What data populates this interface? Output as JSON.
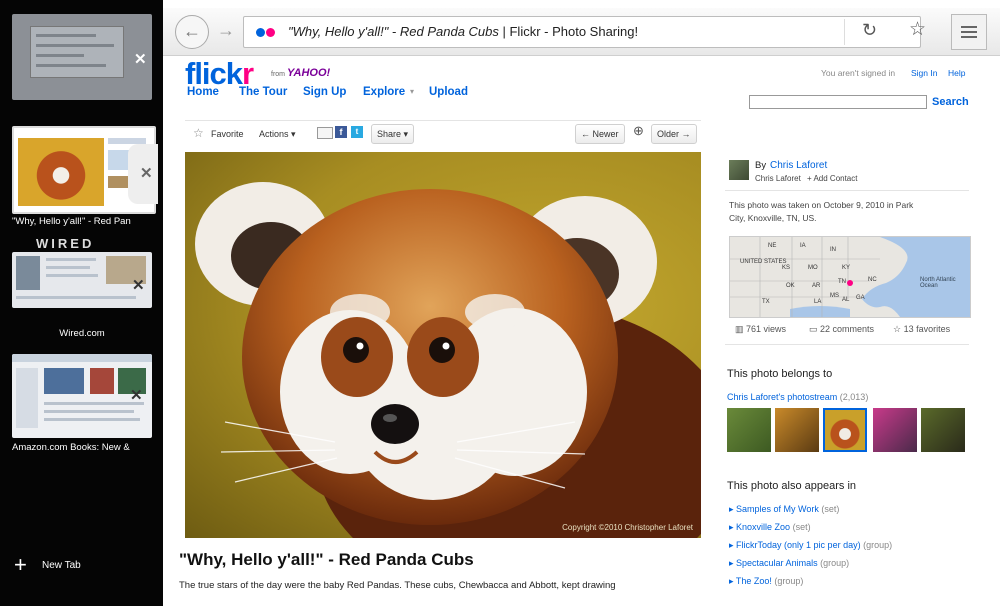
{
  "sidebar": {
    "tabs": [
      {
        "label": ""
      },
      {
        "label": "\"Why, Hello y'all!\" - Red Pan"
      },
      {
        "label": "Wired.com"
      },
      {
        "label": "Amazon.com Books: New &"
      }
    ],
    "wired_logo": "WIRED",
    "new_tab_label": "New Tab"
  },
  "browser": {
    "page_title": "\"Why, Hello y'all!\" - Red Panda Cubs | Flickr - Photo Sharing!",
    "title_italic": "\"Why, Hello y'all!\" - Red Panda Cubs",
    "title_rest": " | Flickr - Photo Sharing!"
  },
  "flickr": {
    "logo_main": "flick",
    "logo_r": "r",
    "from": "from",
    "yahoo": "YAHOO!",
    "nav": [
      "Home",
      "The Tour",
      "Sign Up",
      "Explore",
      "Upload"
    ],
    "not_signed_in": "You aren't signed in",
    "sign_in": "Sign In",
    "help": "Help",
    "search_label": "Search",
    "actions": {
      "favorite": "Favorite",
      "actions": "Actions",
      "share": "Share",
      "newer": "Newer",
      "older": "Older"
    },
    "photo": {
      "copyright": "Copyright ©2010 Christopher Laforet",
      "title": "\"Why, Hello y'all!\" - Red Panda Cubs",
      "description": "The true stars of the day were the baby Red Pandas. These cubs, Chewbacca and Abbott, kept drawing"
    },
    "owner": {
      "by": "By",
      "name": "Chris Laforet",
      "subname": "Chris Laforet",
      "add_contact": "+ Add Contact"
    },
    "taken": {
      "line1": "This photo was taken on October 9, 2010 in Park",
      "line2": "City, Knoxville, TN, US."
    },
    "map_labels": {
      "states": "UNITED STATES",
      "ocean": "North Atlantic Ocean",
      "ne": "NE",
      "ia": "IA",
      "ks": "KS",
      "mo": "MO",
      "ok": "OK",
      "tx": "TX",
      "ar": "AR",
      "tn": "TN",
      "nc": "NC",
      "la": "LA",
      "ms": "MS",
      "al": "AL",
      "ga": "GA",
      "in": "IN",
      "ky": "KY"
    },
    "stats": {
      "views": "761 views",
      "comments": "22 comments",
      "faves": "13 favorites"
    },
    "belongs_heading": "This photo belongs to",
    "photostream_link": "Chris Laforet's photostream",
    "photostream_count": "(2,013)",
    "appears_heading": "This photo also appears in",
    "groups": [
      {
        "name": "Samples of My Work",
        "tag": "(set)"
      },
      {
        "name": "Knoxville Zoo",
        "tag": "(set)"
      },
      {
        "name": "FlickrToday (only 1 pic per day)",
        "tag": "(group)"
      },
      {
        "name": "Spectacular Animals",
        "tag": "(group)"
      },
      {
        "name": "The Zoo!",
        "tag": "(group)"
      }
    ]
  }
}
